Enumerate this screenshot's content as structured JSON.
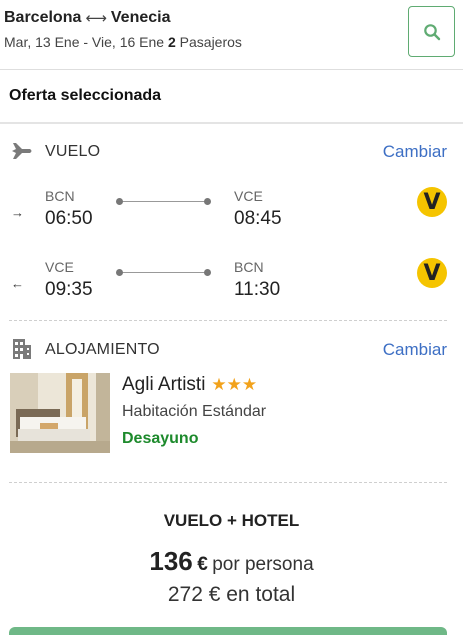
{
  "header": {
    "origin": "Barcelona",
    "route_separator": "⟷",
    "destination": "Venecia",
    "dates": "Mar, 13 Ene - Vie, 16 Ene",
    "passengers_count": "2",
    "passengers_label": "Pasajeros",
    "search_icon": "search-icon"
  },
  "offer": {
    "title": "Oferta seleccionada"
  },
  "flight": {
    "section_label": "VUELO",
    "change_label": "Cambiar",
    "icon": "airplane-icon",
    "legs": [
      {
        "direction_icon": "→",
        "from_code": "BCN",
        "from_time": "06:50",
        "to_code": "VCE",
        "to_time": "08:45",
        "airline_logo": "V"
      },
      {
        "direction_icon": "←",
        "from_code": "VCE",
        "from_time": "09:35",
        "to_code": "BCN",
        "to_time": "11:30",
        "airline_logo": "V"
      }
    ]
  },
  "accommodation": {
    "section_label": "ALOJAMIENTO",
    "change_label": "Cambiar",
    "icon": "building-icon",
    "hotel_name": "Agli Artisti",
    "stars": "★★★",
    "star_rating": 3,
    "room_type": "Habitación Estándar",
    "board": "Desayuno"
  },
  "summary": {
    "package_label": "VUELO + HOTEL",
    "price_amount": "136",
    "price_currency": "€",
    "price_per": "por persona",
    "total_text": "272 € en total"
  },
  "colors": {
    "accent_green": "#5fab72",
    "link_blue": "#3d6fc4",
    "board_green": "#1d8a2c",
    "star_orange": "#f2a21b",
    "airline_yellow": "#f5c400"
  }
}
